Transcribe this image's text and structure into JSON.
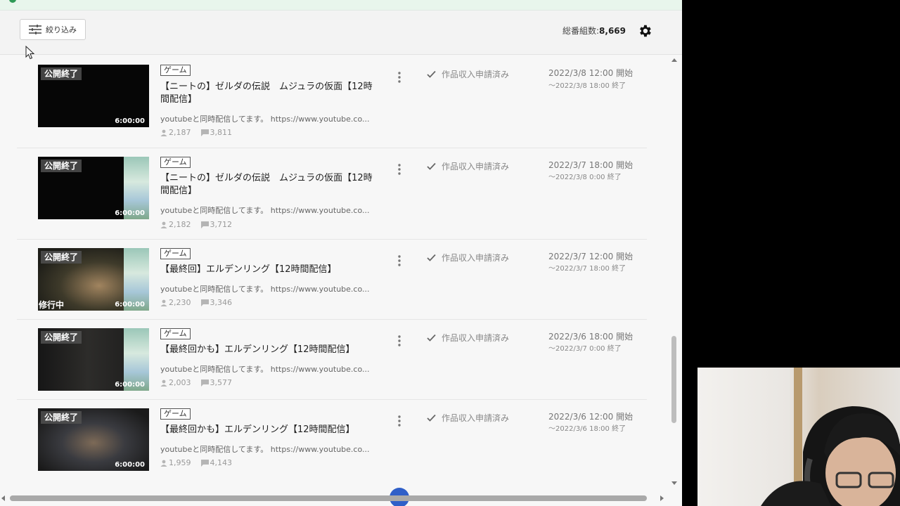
{
  "toolbar": {
    "filter_label": "絞り込み",
    "total_label": "総番組数:",
    "total_value": "8,669"
  },
  "programs": [
    {
      "badge": "公開終了",
      "duration": "6:00:00",
      "overlay_text": "",
      "tag": "ゲーム",
      "title": "【ニートの】ゼルダの伝説　ムジュラの仮面【12時間配信】",
      "description": "youtubeと同時配信してます。 https://www.youtube.co...",
      "viewers": "2,187",
      "comments": "3,811",
      "claim_status": "作品収入申請済み",
      "start": "2022/3/8 12:00 開始",
      "end": "〜2022/3/8 18:00 終了"
    },
    {
      "badge": "公開終了",
      "duration": "6:00:00",
      "overlay_text": "",
      "tag": "ゲーム",
      "title": "【ニートの】ゼルダの伝説　ムジュラの仮面【12時間配信】",
      "description": "youtubeと同時配信してます。 https://www.youtube.co...",
      "viewers": "2,182",
      "comments": "3,712",
      "claim_status": "作品収入申請済み",
      "start": "2022/3/7 18:00 開始",
      "end": "〜2022/3/8 0:00 終了"
    },
    {
      "badge": "公開終了",
      "duration": "6:00:00",
      "overlay_text": "修行中",
      "tag": "ゲーム",
      "title": "【最終回】エルデンリング【12時間配信】",
      "description": "youtubeと同時配信してます。 https://www.youtube.co...",
      "viewers": "2,230",
      "comments": "3,346",
      "claim_status": "作品収入申請済み",
      "start": "2022/3/7 12:00 開始",
      "end": "〜2022/3/7 18:00 終了"
    },
    {
      "badge": "公開終了",
      "duration": "6:00:00",
      "overlay_text": "",
      "tag": "ゲーム",
      "title": "【最終回かも】エルデンリング【12時間配信】",
      "description": "youtubeと同時配信してます。 https://www.youtube.co...",
      "viewers": "2,003",
      "comments": "3,577",
      "claim_status": "作品収入申請済み",
      "start": "2022/3/6 18:00 開始",
      "end": "〜2022/3/7 0:00 終了"
    },
    {
      "badge": "公開終了",
      "duration": "6:00:00",
      "overlay_text": "",
      "tag": "ゲーム",
      "title": "【最終回かも】エルデンリング【12時間配信】",
      "description": "youtubeと同時配信してます。 https://www.youtube.co...",
      "viewers": "1,959",
      "comments": "4,143",
      "claim_status": "作品収入申請済み",
      "start": "2022/3/6 12:00 開始",
      "end": "〜2022/3/6 18:00 終了"
    }
  ]
}
